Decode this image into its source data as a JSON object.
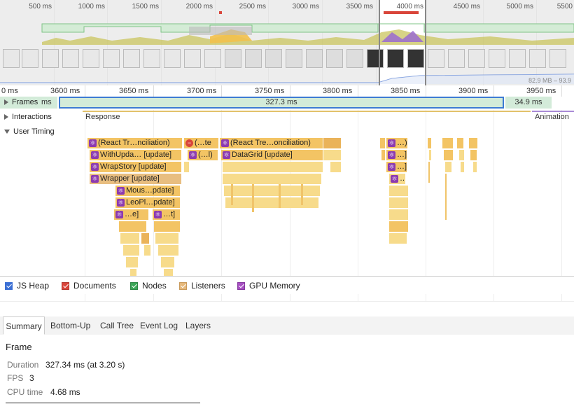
{
  "overview": {
    "ticks": [
      "500 ms",
      "1000 ms",
      "1500 ms",
      "2000 ms",
      "2500 ms",
      "3000 ms",
      "3500 ms",
      "4000 ms",
      "4500 ms",
      "5000 ms",
      "5500"
    ],
    "heap_label": "82.9 MB – 93.9",
    "side_letters": [
      "F",
      "C",
      "N",
      "HE"
    ]
  },
  "ruler": {
    "labels": [
      "0 ms",
      "3600 ms",
      "3650 ms",
      "3700 ms",
      "3750 ms",
      "3800 ms",
      "3850 ms",
      "3900 ms",
      "3950 ms"
    ]
  },
  "tracks": {
    "frames": {
      "label": "Frames",
      "left_value": "ms",
      "main_value": "327.3 ms",
      "right_value": "34.9 ms"
    },
    "interactions": {
      "label": "Interactions",
      "response": "Response",
      "animation": "Animation"
    },
    "user_timing": {
      "label": "User Timing",
      "entries": [
        "(React Tr…nciliation)",
        "(…te",
        "(React Tre…onciliation)",
        "WithUpda… [update]",
        "(…l)",
        "DataGrid [update]",
        "WrapStory [update]",
        "Wrapper [update]",
        "Mous…pdate]",
        "LeoPl…pdate]",
        "…e]",
        "…t]",
        "…)",
        "…]",
        "…]",
        "…"
      ]
    }
  },
  "legend": {
    "items": [
      {
        "label": "JS Heap",
        "color": "#3b6fd4"
      },
      {
        "label": "Documents",
        "color": "#d9453a"
      },
      {
        "label": "Nodes",
        "color": "#3aa757"
      },
      {
        "label": "Listeners",
        "color": "#e6b87a"
      },
      {
        "label": "GPU Memory",
        "color": "#a64fc2"
      }
    ]
  },
  "tabs": [
    "Summary",
    "Bottom-Up",
    "Call Tree",
    "Event Log",
    "Layers"
  ],
  "active_tab": "Summary",
  "summary": {
    "title": "Frame",
    "duration_label": "Duration",
    "duration_value": "327.34 ms (at 3.20 s)",
    "fps_label": "FPS",
    "fps_value": "3",
    "cpu_label": "CPU time",
    "cpu_value": "4.68 ms"
  }
}
